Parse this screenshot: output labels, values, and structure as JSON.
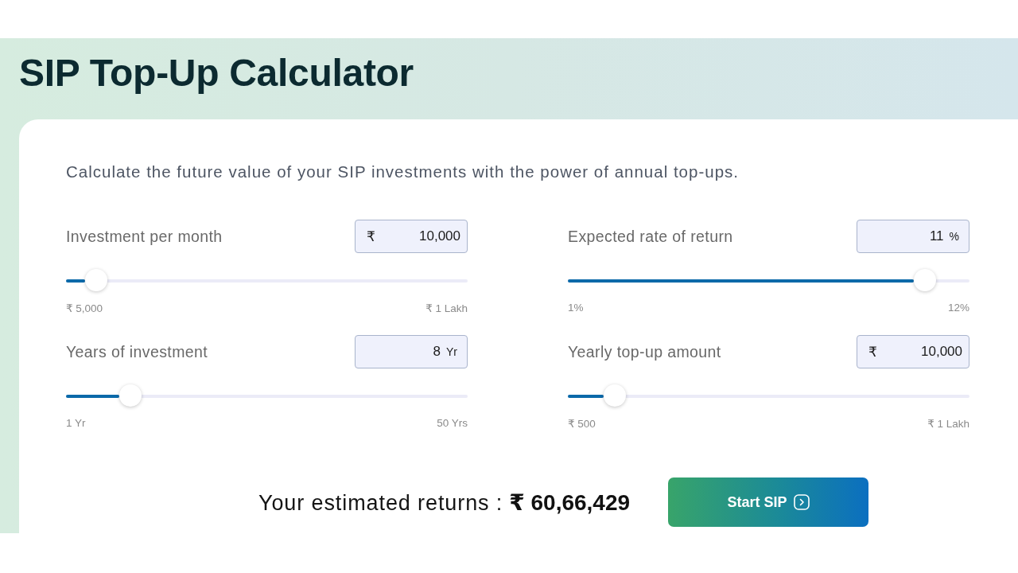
{
  "title": "SIP Top-Up Calculator",
  "description": "Calculate the future value of your SIP investments with the power of annual top-ups.",
  "inputs": [
    {
      "label": "Investment per month",
      "prefix": "₹",
      "value": "10,000",
      "level": 0.075,
      "min_label": "₹ 5,000",
      "max_label": "₹ 1 Lakh"
    },
    {
      "label": "Expected rate of return",
      "value": "11",
      "suffix": "%",
      "level": 0.89,
      "min_label": "1%",
      "max_label": "12%"
    },
    {
      "label": "Years of investment",
      "value": "8",
      "suffix": "Yr",
      "level": 0.16,
      "min_label": "1 Yr",
      "max_label": "50 Yrs"
    },
    {
      "label": "Yearly top-up amount",
      "prefix": "₹",
      "value": "10,000",
      "level": 0.117,
      "min_label": "₹ 500",
      "max_label": "₹ 1 Lakh"
    }
  ],
  "result": {
    "label": "Your estimated returns :",
    "value": "₹ 60,66,429"
  },
  "button": {
    "label": "Start SIP"
  }
}
